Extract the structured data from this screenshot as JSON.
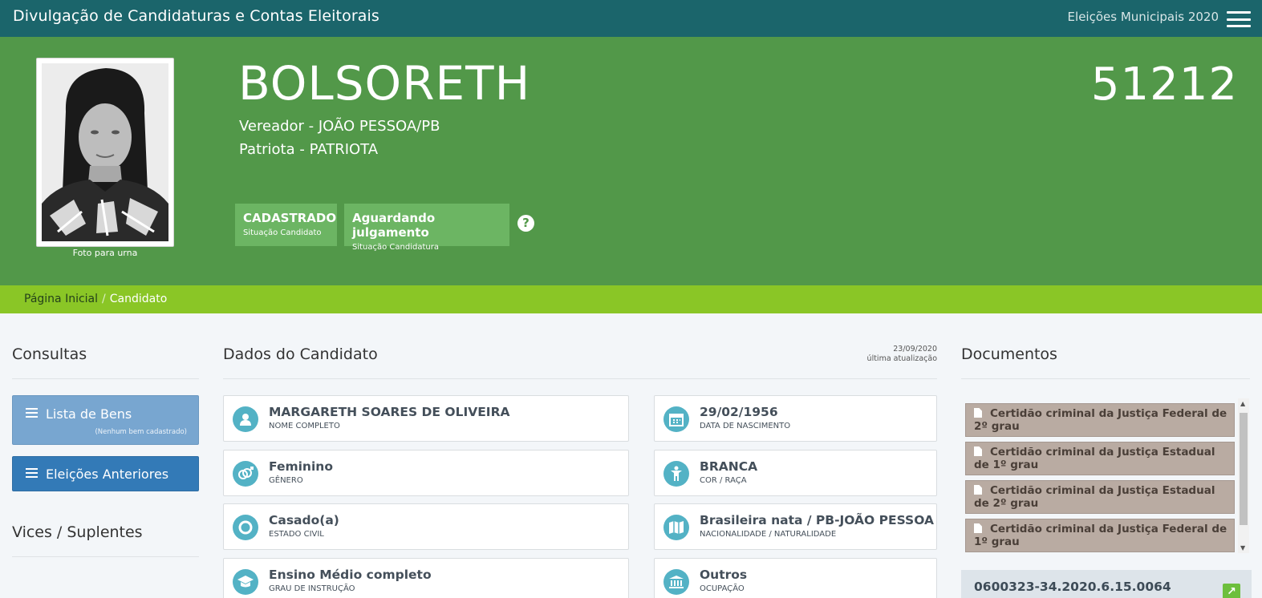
{
  "topbar": {
    "brand": "Divulgação de Candidaturas e Contas Eleitorais",
    "election": "Eleições Municipais 2020"
  },
  "candidate": {
    "photo_caption": "Foto para urna",
    "name": "BOLSORETH",
    "office": "Vereador - JOÃO PESSOA/PB",
    "party": "Patriota - PATRIOTA",
    "number": "51212",
    "status": [
      {
        "value": "CADASTRADO",
        "label": "Situação Candidato"
      },
      {
        "value": "Aguardando julgamento",
        "label": "Situação Candidatura"
      }
    ],
    "help": "?"
  },
  "breadcrumb": {
    "home": "Página Inicial",
    "separator": "/",
    "current": "Candidato"
  },
  "consultas": {
    "title": "Consultas",
    "lista_bens": {
      "label": "Lista de Bens",
      "sub": "(Nenhum bem cadastrado)"
    },
    "eleicoes_anteriores": "Eleições Anteriores",
    "vices_title": "Vices / Suplentes"
  },
  "dados": {
    "title": "Dados do Candidato",
    "updated_date": "23/09/2020",
    "updated_label": "última atualização",
    "left": [
      {
        "value": "MARGARETH SOARES DE OLIVEIRA",
        "label": "NOME COMPLETO",
        "icon": "user-icon"
      },
      {
        "value": "Feminino",
        "label": "GÊNERO",
        "icon": "gender-icon"
      },
      {
        "value": "Casado(a)",
        "label": "ESTADO CIVIL",
        "icon": "ring-icon"
      },
      {
        "value": "Ensino Médio completo",
        "label": "GRAU DE INSTRUÇÃO",
        "icon": "graduation-cap-icon"
      }
    ],
    "right": [
      {
        "value": "29/02/1956",
        "label": "DATA DE NASCIMENTO",
        "icon": "calendar-icon"
      },
      {
        "value": "BRANCA",
        "label": "COR / RAÇA",
        "icon": "person-icon"
      },
      {
        "value": "Brasileira nata / PB-JOÃO PESSOA",
        "label": "NACIONALIDADE / NATURALIDADE",
        "icon": "map-icon"
      },
      {
        "value": "Outros",
        "label": "OCUPAÇÃO",
        "icon": "building-icon"
      }
    ]
  },
  "documentos": {
    "title": "Documentos",
    "items": [
      "Certidão criminal da Justiça Federal de 2º grau",
      "Certidão criminal da Justiça Estadual de 1º grau",
      "Certidão criminal da Justiça Estadual de 2º grau",
      "Certidão criminal da Justiça Federal de 1º grau"
    ],
    "processo": "0600323-34.2020.6.15.0064"
  },
  "colors": {
    "topbar": "#1b656b",
    "hero": "#529849",
    "breadcrumb": "#8ac626",
    "status": "#6cb563",
    "icon_circle": "#53b2c5",
    "btn_primary": "#337ab7",
    "doc_item": "#b9aba2"
  }
}
